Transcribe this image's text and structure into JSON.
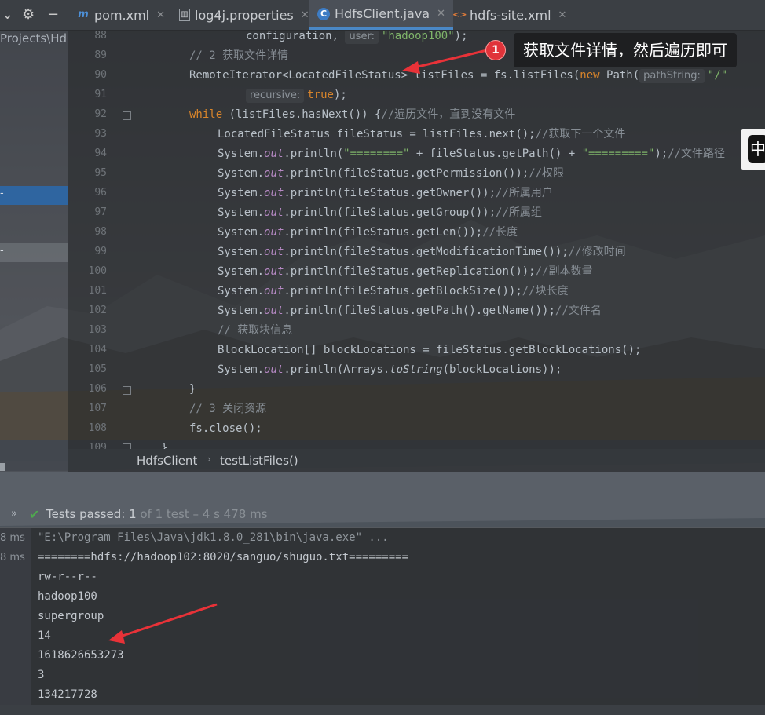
{
  "tabs": [
    {
      "label": "pom.xml",
      "icon": "maven-icon",
      "active": false
    },
    {
      "label": "log4j.properties",
      "icon": "properties-file-icon",
      "active": false
    },
    {
      "label": "HdfsClient.java",
      "icon": "java-class-icon",
      "active": true
    },
    {
      "label": "hdfs-site.xml",
      "icon": "xml-file-icon",
      "active": false
    }
  ],
  "project_panel": {
    "path": "Projects\\Hd"
  },
  "editor": {
    "line_numbers": [
      "88",
      "89",
      "90",
      "91",
      "92",
      "93",
      "94",
      "95",
      "96",
      "97",
      "98",
      "99",
      "100",
      "101",
      "102",
      "103",
      "104",
      "105",
      "106",
      "107",
      "108",
      "109"
    ],
    "hints": {
      "user": "user:",
      "pathString": "pathString:",
      "recursive": "recursive:"
    },
    "lines": {
      "l88_code": "configuration, ",
      "l88_str": "\"hadoop100\"",
      "l88_tail": ");",
      "l89": "// 2 获取文件详情",
      "l90_a": "RemoteIterator<LocatedFileStatus> listFiles = fs.listFiles(",
      "l90_new": "new",
      "l90_b": " Path(",
      "l90_str": "\"/\"",
      "l91_true": "true",
      "l91_tail": ");",
      "l92_while": "while",
      "l92_code": " (listFiles.hasNext()) {",
      "l92_cm": "//遍历文件，直到没有文件",
      "l93_code": "LocatedFileStatus fileStatus = listFiles.next();",
      "l93_cm": "//获取下一个文件",
      "sys": "System.",
      "out": "out",
      "l94_a": ".println(",
      "l94_s1": "\"========\"",
      "l94_b": " + fileStatus.getPath() + ",
      "l94_s2": "\"=========\"",
      "l94_c": ");",
      "l94_cm": "//文件路径",
      "l95_code": ".println(fileStatus.getPermission());",
      "l95_cm": "//权限",
      "l96_code": ".println(fileStatus.getOwner());",
      "l96_cm": "//所属用户",
      "l97_code": ".println(fileStatus.getGroup());",
      "l97_cm": "//所属组",
      "l98_code": ".println(fileStatus.getLen());",
      "l98_cm": "//长度",
      "l99_code": ".println(fileStatus.getModificationTime());",
      "l99_cm": "//修改时间",
      "l100_code": ".println(fileStatus.getReplication());",
      "l100_cm": "//副本数量",
      "l101_code": ".println(fileStatus.getBlockSize());",
      "l101_cm": "//块长度",
      "l102_code": ".println(fileStatus.getPath().getName());",
      "l102_cm": "//文件名",
      "l103": "// 获取块信息",
      "l104": "BlockLocation[] blockLocations = fileStatus.getBlockLocations();",
      "l105_a": ".println(Arrays.",
      "l105_it": "toString",
      "l105_b": "(blockLocations));",
      "l106": "}",
      "l107": "// 3 关闭资源",
      "l108": "fs.close();",
      "l109": "}"
    }
  },
  "breadcrumb": {
    "class": "HdfsClient",
    "separator": "›",
    "method": "testListFiles()"
  },
  "run": {
    "expand": "»",
    "status": "Tests passed:",
    "count": "1",
    "detail": "of 1 test – 4 s 478 ms",
    "left_times": [
      "8 ms",
      "8 ms"
    ],
    "console": [
      "\"E:\\Program Files\\Java\\jdk1.8.0_281\\bin\\java.exe\" ...",
      "========hdfs://hadoop102:8020/sanguo/shuguo.txt=========",
      "rw-r--r--",
      "hadoop100",
      "supergroup",
      "14",
      "1618626653273",
      "3",
      "134217728"
    ]
  },
  "annotation": {
    "badge": "1",
    "text": "获取文件详情，然后遍历即可"
  },
  "ime": {
    "label": "中"
  },
  "colors": {
    "keyword": "#d9852b",
    "comment": "#868d94",
    "string": "#7fb56a",
    "accent": "#4a88c7",
    "badge": "#e0333a"
  }
}
